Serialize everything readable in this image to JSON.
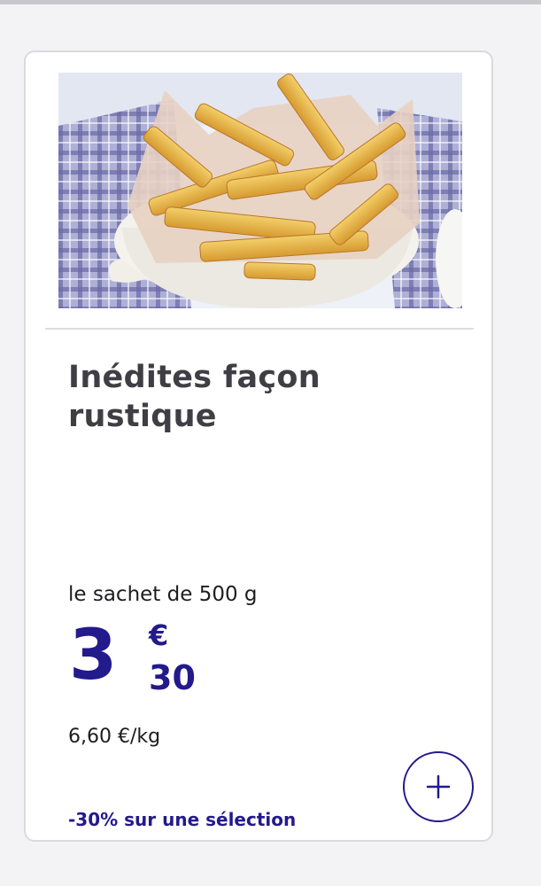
{
  "product": {
    "image_alt": "frites rustiques dans un plat",
    "title_line1": "Inédites façon",
    "title_line2": "rustique",
    "unit_label": "le sachet de 500 g",
    "price_int": "3",
    "price_currency": "€",
    "price_cents": "30",
    "price_per_kg": "6,60 €/kg",
    "promo_text": "-30% sur une sélection"
  },
  "actions": {
    "add_icon": "plus-icon"
  },
  "colors": {
    "accent": "#231a8c",
    "title": "#3e3e44",
    "card_border": "#dadade",
    "background": "#f3f3f5"
  }
}
